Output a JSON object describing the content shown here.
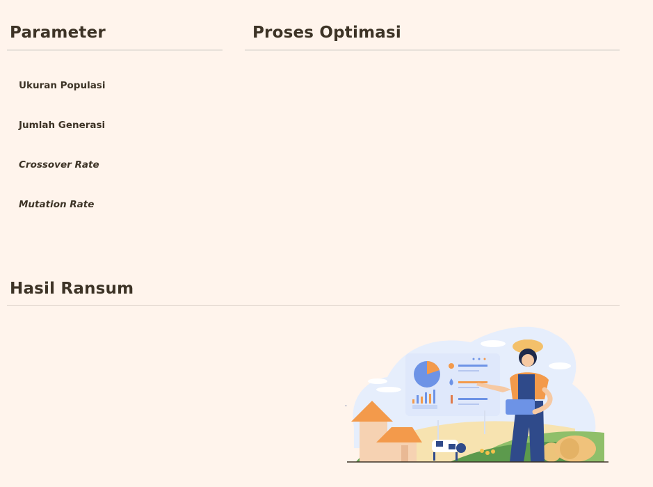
{
  "parameter": {
    "title": "Parameter",
    "labels": [
      "Ukuran Populasi",
      "Jumlah Generasi",
      "Crossover Rate",
      "Mutation Rate"
    ]
  },
  "proses": {
    "title": "Proses Optimasi"
  },
  "hasil": {
    "title": "Hasil Ransum"
  },
  "colors": {
    "background": "#fff4ec",
    "text": "#3d3326",
    "divider": "#e8e1da",
    "accent_orange": "#f39a4b",
    "accent_blue": "#6d93e6",
    "overall_blue": "#2f4a8a"
  },
  "illustration": {
    "icon": "smart-farming-illustration"
  }
}
